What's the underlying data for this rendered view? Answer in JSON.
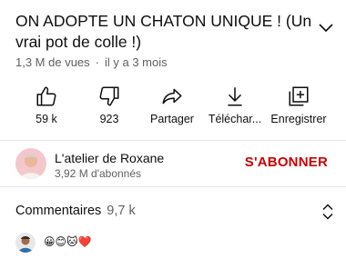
{
  "video": {
    "title": "ON ADOPTE UN CHATON UNIQUE ! (Un vrai pot de colle !)",
    "views": "1,3 M de vues",
    "separator": "·",
    "age": "il y a 3 mois"
  },
  "actions": [
    {
      "icon": "thumbs-up-icon",
      "label": "59 k"
    },
    {
      "icon": "thumbs-down-icon",
      "label": "923"
    },
    {
      "icon": "share-icon",
      "label": "Partager"
    },
    {
      "icon": "download-icon",
      "label": "Téléchar..."
    },
    {
      "icon": "save-playlist-icon",
      "label": "Enregistrer"
    }
  ],
  "channel": {
    "name": "L'atelier de Roxane",
    "subscribers": "3,92 M d'abonnés",
    "subscribe_label": "S'ABONNER",
    "subscribe_color": "#cc0000"
  },
  "comments": {
    "label": "Commentaires",
    "count": "9,7 k",
    "preview_text": "😀😊🐱❤️"
  },
  "colors": {
    "text_primary": "#0f0f0f",
    "text_secondary": "#606060",
    "divider": "#e5e5e5"
  }
}
